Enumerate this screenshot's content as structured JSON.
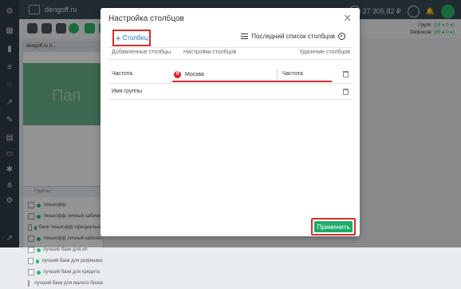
{
  "topbar": {
    "site": "dengoff.ru",
    "balance": "27 305,82 ₽"
  },
  "stats": {
    "groups_label": "Групп:",
    "groups_value": "(16 ● 0 ●)",
    "queries_label": "Запросов:",
    "queries_value": "(85 ● 0 ●)"
  },
  "left_panel": {
    "tab": "dengoff.ru (i...",
    "watermark": "Пап",
    "groups_header": "Группы",
    "items": [
      "тинькофф",
      "тинькофф личный кабинет",
      "банк тинькофф официальны",
      "тинькофф личный кабинет",
      "лучший банк для ип",
      "лучший банк для рефинанс",
      "лучший банк для кредита",
      "лучший банк для малого бизнеса"
    ]
  },
  "modal": {
    "title": "Настройка столбцов",
    "add_column_label": "Столбец",
    "last_list_label": "Последний список столбцов",
    "col_headers": {
      "added": "Добавленные столбцы",
      "settings": "Настройки столбцов",
      "delete": "Удаление столбцов"
    },
    "rows": [
      {
        "label": "Частота",
        "region": "Москва",
        "setting": "Частота"
      },
      {
        "label": "Имя группы"
      }
    ],
    "apply_label": "Применить"
  },
  "colors": {
    "accent_red": "#d62d2d",
    "apply_green": "#1fab68",
    "link_blue": "#2273c9"
  },
  "icons": [
    "close-icon",
    "plus-icon",
    "list-icon",
    "gear-icon",
    "yandex-icon",
    "trash-icon"
  ]
}
